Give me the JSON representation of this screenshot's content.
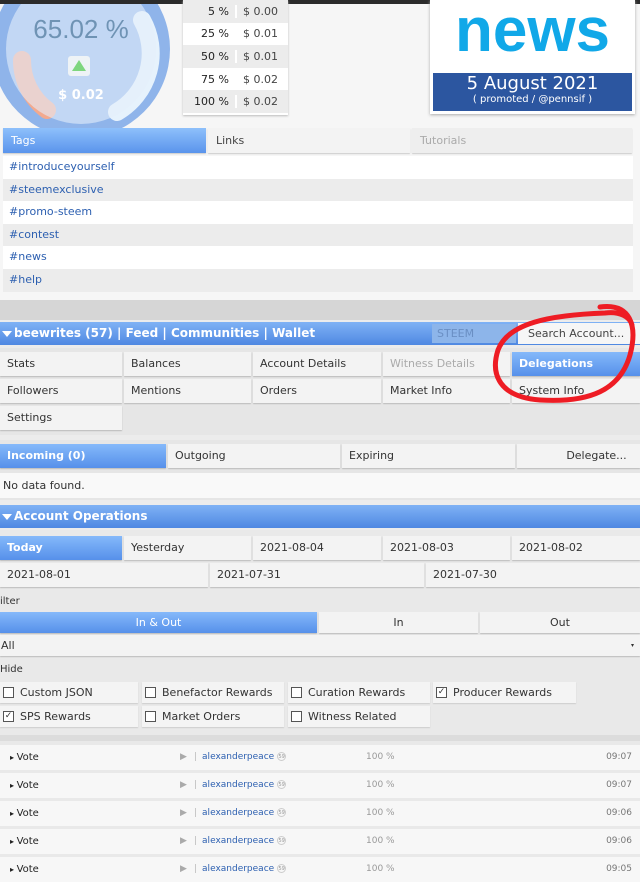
{
  "vote_gauge": {
    "percent": "65.02 %",
    "value": "$ 0.02"
  },
  "vote_values": [
    {
      "pct": "5 %",
      "val": "$ 0.00"
    },
    {
      "pct": "25 %",
      "val": "$ 0.01"
    },
    {
      "pct": "50 %",
      "val": "$ 0.01"
    },
    {
      "pct": "75 %",
      "val": "$ 0.02"
    },
    {
      "pct": "100 %",
      "val": "$ 0.02"
    }
  ],
  "news": {
    "word": "news",
    "date": "5 August 2021",
    "promo": "( promoted / @pennsif )"
  },
  "info_tabs": [
    "Tags",
    "Links",
    "Tutorials"
  ],
  "tags": [
    "#introduceyourself",
    "#steemexclusive",
    "#promo-steem",
    "#contest",
    "#news",
    "#help"
  ],
  "account_bar": {
    "user": "beewrites (57)",
    "feed": "Feed",
    "communities": "Communities",
    "wallet": "Wallet",
    "chain_select": "STEEM",
    "search": "Search Account..."
  },
  "nav": [
    "Stats",
    "Balances",
    "Account Details",
    "Witness Details",
    "Delegations",
    "Followers",
    "Mentions",
    "Orders",
    "Market Info",
    "System Info",
    "Settings"
  ],
  "delegation_tabs": [
    "Incoming (0)",
    "Outgoing",
    "Expiring",
    "Delegate..."
  ],
  "no_data": "No data found.",
  "operations": {
    "title": "Account Operations",
    "dates": [
      "Today",
      "Yesterday",
      "2021-08-04",
      "2021-08-03",
      "2021-08-02",
      "2021-08-01",
      "2021-07-31",
      "2021-07-30"
    ],
    "filter_label": "ilter",
    "direction": [
      "In & Out",
      "In",
      "Out"
    ],
    "type_select": "All",
    "hide_label": "Hide",
    "hide_options": [
      {
        "label": "Custom JSON",
        "checked": false
      },
      {
        "label": "Benefactor Rewards",
        "checked": false
      },
      {
        "label": "Curation Rewards",
        "checked": false
      },
      {
        "label": "Producer Rewards",
        "checked": true
      },
      {
        "label": "SPS Rewards",
        "checked": true
      },
      {
        "label": "Market Orders",
        "checked": false
      },
      {
        "label": "Witness Related",
        "checked": false
      }
    ],
    "rows": [
      {
        "type": "Vote",
        "user": "alexanderpeace",
        "rep": "59",
        "weight": "100 %",
        "time": "09:07"
      },
      {
        "type": "Vote",
        "user": "alexanderpeace",
        "rep": "59",
        "weight": "100 %",
        "time": "09:07"
      },
      {
        "type": "Vote",
        "user": "alexanderpeace",
        "rep": "59",
        "weight": "100 %",
        "time": "09:06"
      },
      {
        "type": "Vote",
        "user": "alexanderpeace",
        "rep": "59",
        "weight": "100 %",
        "time": "09:06"
      },
      {
        "type": "Vote",
        "user": "alexanderpeace",
        "rep": "59",
        "weight": "100 %",
        "time": "09:05"
      }
    ]
  },
  "colors": {
    "accent": "#5a94ec",
    "annotation": "#ee1c24",
    "news_blue": "#2c56a0"
  }
}
